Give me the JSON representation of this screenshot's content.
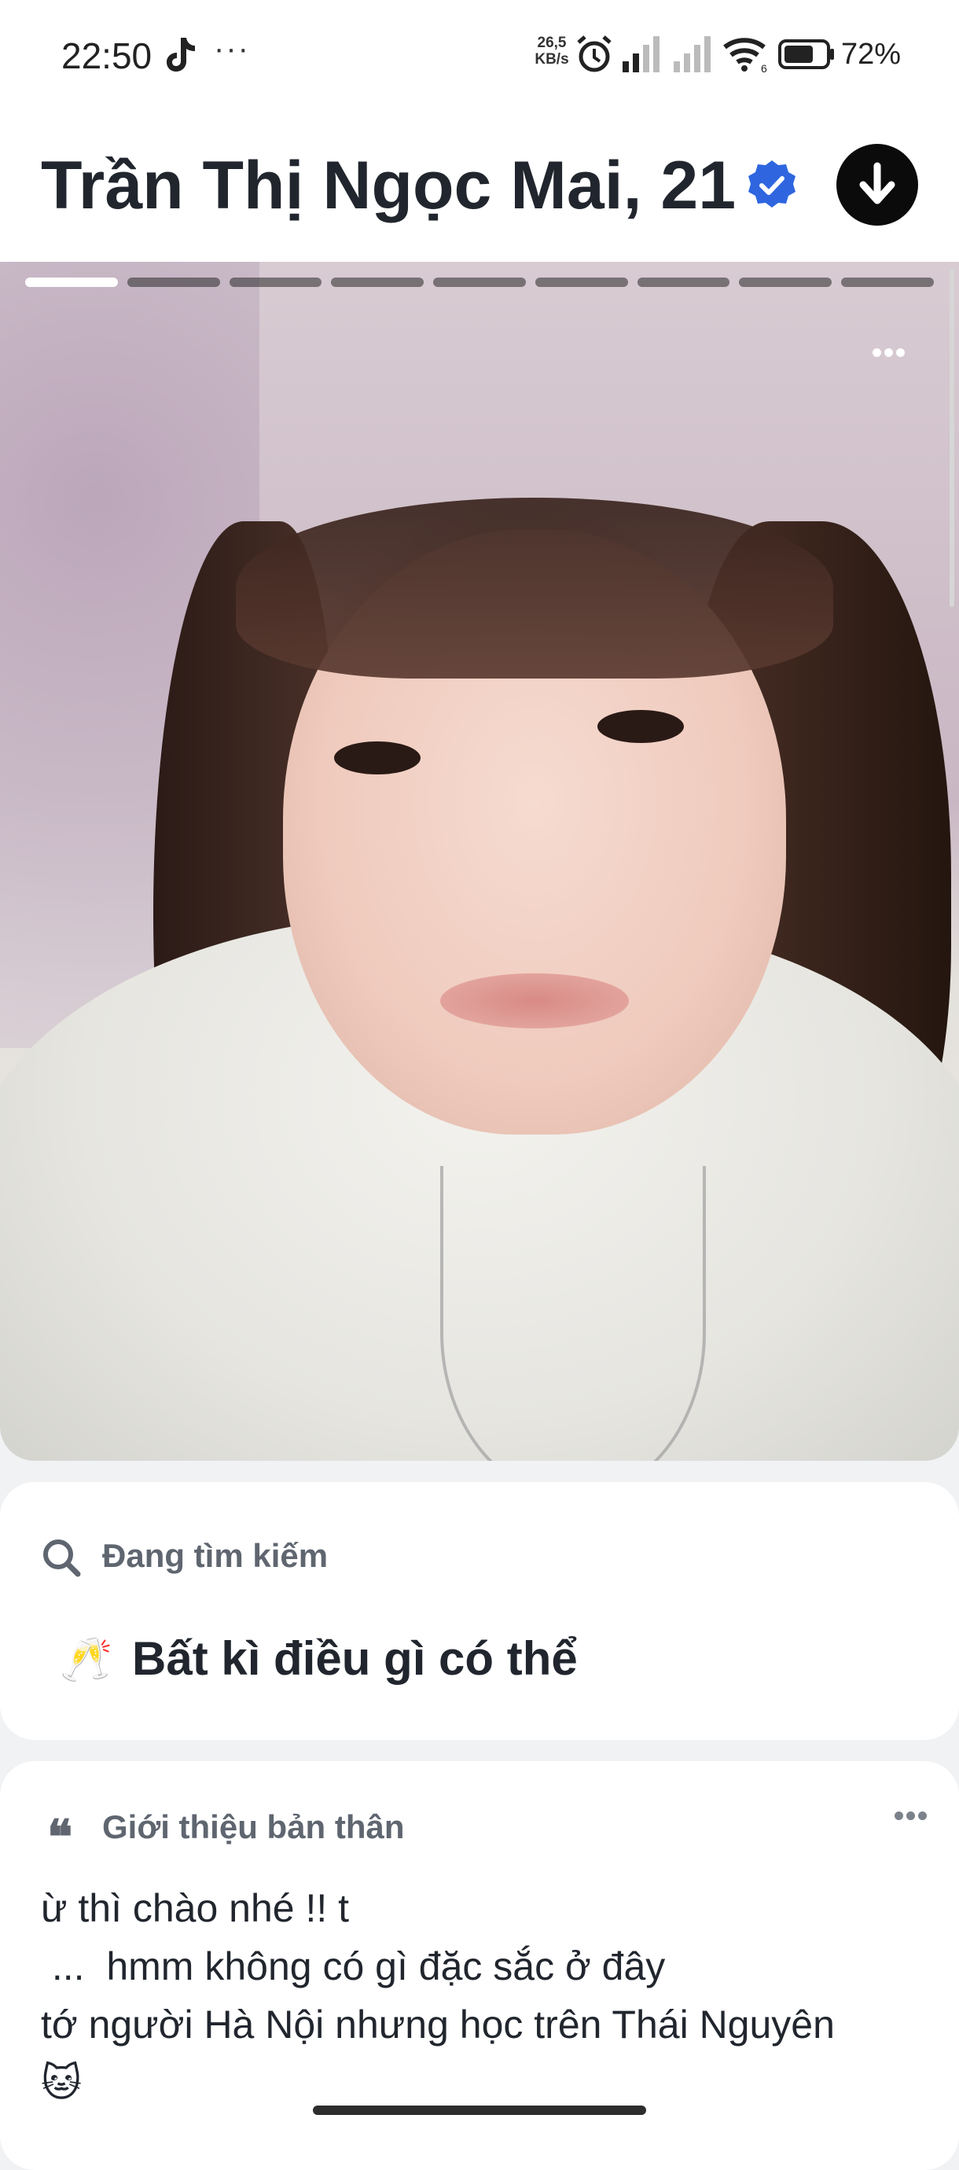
{
  "status_bar": {
    "time": "22:50",
    "more": "···",
    "speed_value": "26,5",
    "speed_unit": "KB/s",
    "wifi_label": "6",
    "battery": "72%",
    "icons": [
      "tiktok-icon",
      "alarm-icon",
      "signal-icon",
      "signal-icon",
      "wifi-icon",
      "battery-icon"
    ]
  },
  "profile": {
    "name_age": "Trần Thị Ngọc Mai, 21",
    "verified": true,
    "photo_count": 9,
    "photo_index": 1
  },
  "looking_for": {
    "label": "Đang tìm kiếm",
    "emoji": "🥂",
    "value": "Bất kì điều gì có thể"
  },
  "about": {
    "label": "Giới thiệu bản thân",
    "quote_glyph": "❝",
    "lines": [
      "ừ thì chào nhé !! t",
      " ...  hmm không có gì đặc sắc ở đây",
      "tớ người Hà Nội nhưng học trên Thái Nguyên",
      "🐱"
    ]
  },
  "colors": {
    "verified_blue": "#2f66e0",
    "text_dark": "#21262e",
    "label_gray": "#5f6670",
    "page_bg": "#f0f2f4"
  }
}
